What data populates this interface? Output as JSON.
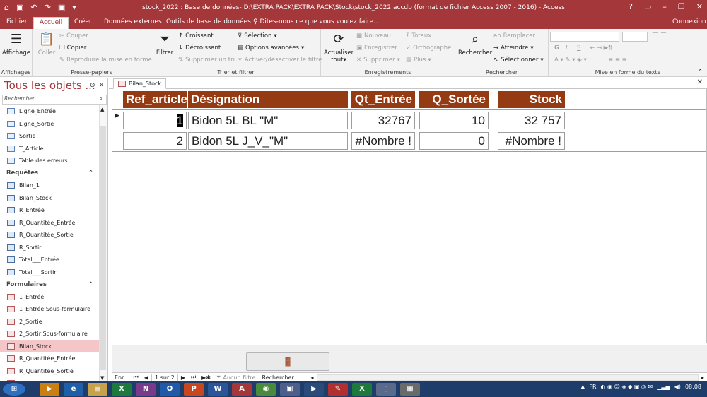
{
  "window": {
    "title": "stock_2022 : Base de données- D:\\EXTRA PACK\\EXTRA PACK\\Stock\\stock_2022.accdb (format de fichier Access 2007 - 2016) - Access",
    "help": "?"
  },
  "tabs": [
    "Fichier",
    "Accueil",
    "Créer",
    "Données externes",
    "Outils de base de données"
  ],
  "tellme": "Dites-nous ce que vous voulez faire...",
  "signin": "Connexion",
  "ribbon": {
    "affichage": "Affichage",
    "coller": "Coller",
    "couper": "Couper",
    "copier": "Copier",
    "reproduire": "Reproduire la mise en forme",
    "g_clip": "Presse-papiers",
    "g_view": "Affichages",
    "filtrer": "Filtrer",
    "croissant": "Croissant",
    "decroissant": "Décroissant",
    "suppr_tri": "Supprimer un tri",
    "selection": "Sélection",
    "options_av": "Options avancées",
    "activer": "Activer/désactiver le filtre",
    "g_sort": "Trier et filtrer",
    "actualiser": "Actualiser",
    "tout": "tout",
    "nouveau": "Nouveau",
    "enregistrer": "Enregistrer",
    "supprimer": "Supprimer",
    "totaux": "Totaux",
    "orthographe": "Orthographe",
    "plus": "Plus",
    "g_rec": "Enregistrements",
    "rechercher": "Rechercher",
    "remplacer": "Remplacer",
    "atteindre": "Atteindre",
    "selectionner": "Sélectionner",
    "g_find": "Rechercher",
    "g_fmt": "Mise en forme du texte"
  },
  "nav": {
    "title": "Tous les objets ...",
    "search": "Rechercher...",
    "tables": [
      "Ligne_Entrée",
      "Ligne_Sortie",
      "Sortie",
      "T_Article",
      "Table des erreurs"
    ],
    "sec_req": "Requêtes",
    "queries": [
      "Bilan_1",
      "Bilan_Stock",
      "R_Entrée",
      "R_Quantitée_Entrée",
      "R_Quantitée_Sortie",
      "R_Sortir",
      "Total___Entrée",
      "Total___Sortir"
    ],
    "sec_form": "Formulaires",
    "forms": [
      "1_Entrée",
      "1_Entrée Sous-formulaire",
      "2_Sortie",
      "2_Sortir Sous-formulaire",
      "Bilan_Stock",
      "R_Quantitée_Entrée",
      "R_Quantitée_Sortie",
      "T_Article"
    ]
  },
  "doc": {
    "tab": "Bilan_Stock"
  },
  "grid": {
    "headers": [
      "Ref_article",
      "Désignation",
      "Qt_Entrée",
      "Q_Sortée",
      "Stock"
    ],
    "rows": [
      [
        "1",
        "Bidon 5L BL \"M\"",
        "32767",
        "10",
        "32 757"
      ],
      [
        "2",
        "Bidon 5L J_V_\"M\"",
        "#Nombre !",
        "0",
        "#Nombre !"
      ]
    ]
  },
  "recnav": {
    "label": "Enr :",
    "pos": "1 sur 2",
    "nofilter": "Aucun filtre",
    "search": "Rechercher"
  },
  "tray": {
    "lang": "FR",
    "time": "08:08"
  },
  "colors": {
    "accent": "#a4373a",
    "header": "#943b13"
  }
}
